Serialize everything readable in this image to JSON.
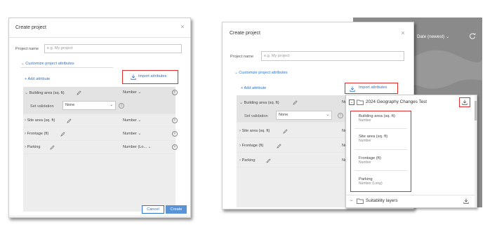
{
  "left_dialog": {
    "title": "Create project",
    "close": "×",
    "project_name_label": "Project name",
    "project_name_placeholder": "e.g. My project",
    "customize_label": "Customize project attributes",
    "add_attribute": "+ Add attribute",
    "import_attributes": "Import attributes",
    "attributes": [
      {
        "name": "Building area (sq. ft)",
        "type": "Number"
      },
      {
        "name": "Site area (sq. ft)",
        "type": "Number"
      },
      {
        "name": "Frontage (ft)",
        "type": "Number"
      },
      {
        "name": "Parking",
        "type": "Number (Lo..."
      }
    ],
    "set_validation_label": "Set validation",
    "validation_value": "None",
    "cancel_label": "Cancel",
    "create_label": "Create"
  },
  "right_dialog": {
    "title": "Create project",
    "close": "×",
    "project_name_label": "Project name",
    "project_name_placeholder": "e.g. My project",
    "customize_label": "Customize project attributes",
    "add_attribute": "+ Add attribute",
    "import_attributes": "Import attributes",
    "attributes": [
      {
        "name": "Building area (sq. ft)",
        "type": "Nu"
      },
      {
        "name": "Site area (sq. ft)",
        "type": "Nu"
      },
      {
        "name": "Frontage (ft)",
        "type": "Nu"
      },
      {
        "name": "Parking",
        "type": "Nu"
      }
    ],
    "set_validation_label": "Set validation",
    "validation_value": "None"
  },
  "background": {
    "sort_label": "Date (newest)"
  },
  "import_panel": {
    "header": "2024 Geography Changes Test",
    "items": [
      {
        "title": "Building area (sq. ft)",
        "subtitle": "Number"
      },
      {
        "title": "Site area (sq. ft)",
        "subtitle": "Number"
      },
      {
        "title": "Frontage (ft)",
        "subtitle": "Number"
      },
      {
        "title": "Parking",
        "subtitle": "Number (Long)"
      }
    ],
    "footer_group": "Suitability layers"
  },
  "colors": {
    "accent_blue": "#2e74c8",
    "highlight_red": "#e02d2d",
    "create_button": "#5a93d6"
  }
}
